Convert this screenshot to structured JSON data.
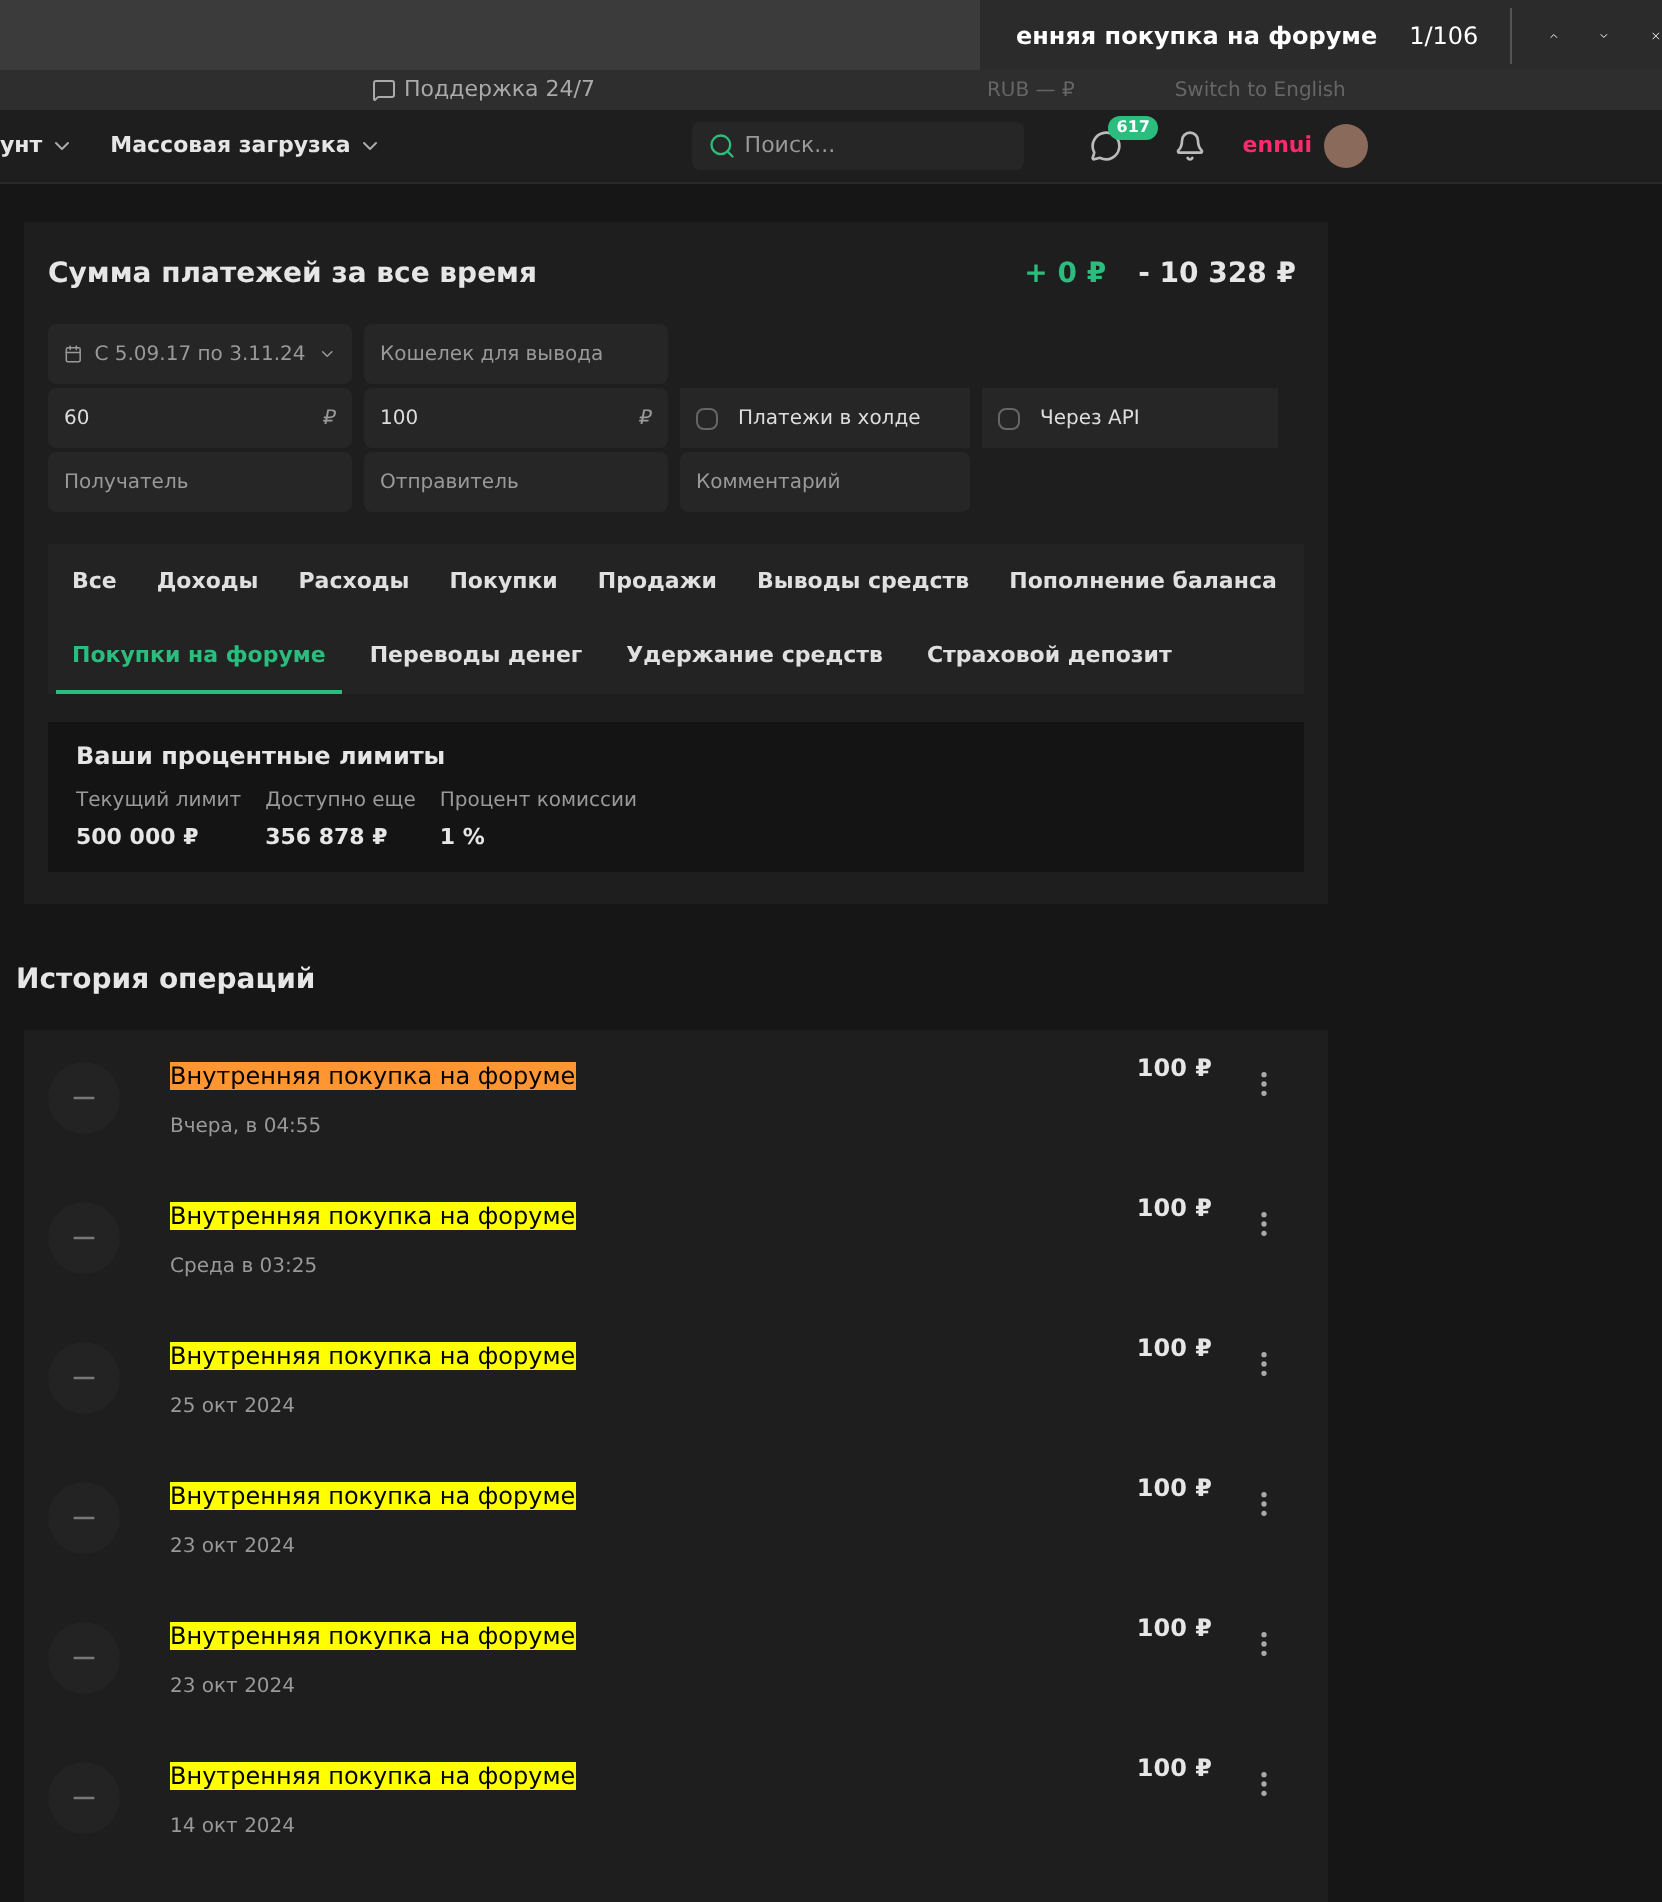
{
  "find_bar": {
    "query": "енняя покупка на форуме",
    "count": "1/106"
  },
  "top_bar": {
    "support": "Поддержка 24/7",
    "currency": "RUB — ₽",
    "language": "Switch to English"
  },
  "nav": {
    "items": [
      "унт",
      "Массовая загрузка"
    ],
    "search": {
      "placeholder": "Поиск..."
    },
    "messages_badge": "617",
    "username": "ennui"
  },
  "summary": {
    "title": "Сумма платежей за все время",
    "income": "+ 0 ₽",
    "expense": "- 10 328 ₽",
    "filters": {
      "date": "С 5.09.17 по 3.11.24",
      "wallet": {
        "placeholder": "Кошелек для вывода"
      },
      "min": {
        "value": "60",
        "unit": "₽"
      },
      "max": {
        "value": "100",
        "unit": "₽"
      },
      "checkboxes": [
        {
          "label": "Платежи в холде",
          "checked": false
        },
        {
          "label": "Через API",
          "checked": false
        }
      ],
      "recipient": {
        "placeholder": "Получатель"
      },
      "sender": {
        "placeholder": "Отправитель"
      },
      "comment": {
        "placeholder": "Комментарий"
      }
    },
    "tabs": [
      {
        "label": "Все",
        "selected": false
      },
      {
        "label": "Доходы",
        "selected": false
      },
      {
        "label": "Расходы",
        "selected": false
      },
      {
        "label": "Покупки",
        "selected": false
      },
      {
        "label": "Продажи",
        "selected": false
      },
      {
        "label": "Выводы средств",
        "selected": false
      },
      {
        "label": "Пополнение баланса",
        "selected": false
      },
      {
        "label": "Покупки на форуме",
        "selected": true
      },
      {
        "label": "Переводы денег",
        "selected": false
      },
      {
        "label": "Удержание средств",
        "selected": false
      },
      {
        "label": "Страховой депозит",
        "selected": false
      }
    ],
    "limits": {
      "title": "Ваши процентные лимиты",
      "items": [
        {
          "label": "Текущий лимит",
          "value": "500 000 ₽"
        },
        {
          "label": "Доступно еще",
          "value": "356 878 ₽"
        },
        {
          "label": "Процент комиссии",
          "value": "1 %"
        }
      ]
    }
  },
  "history": {
    "title": "История операций",
    "operations": [
      {
        "title": "Внутренняя покупка на форуме",
        "current_match": true,
        "date": "Вчера, в 04:55",
        "amount": "100 ₽"
      },
      {
        "title": "Внутренняя покупка на форуме",
        "current_match": false,
        "date": "Среда в 03:25",
        "amount": "100 ₽"
      },
      {
        "title": "Внутренняя покупка на форуме",
        "current_match": false,
        "date": "25 окт 2024",
        "amount": "100 ₽"
      },
      {
        "title": "Внутренняя покупка на форуме",
        "current_match": false,
        "date": "23 окт 2024",
        "amount": "100 ₽"
      },
      {
        "title": "Внутренняя покупка на форуме",
        "current_match": false,
        "date": "23 окт 2024",
        "amount": "100 ₽"
      },
      {
        "title": "Внутренняя покупка на форуме",
        "current_match": false,
        "date": "14 окт 2024",
        "amount": "100 ₽"
      }
    ]
  }
}
